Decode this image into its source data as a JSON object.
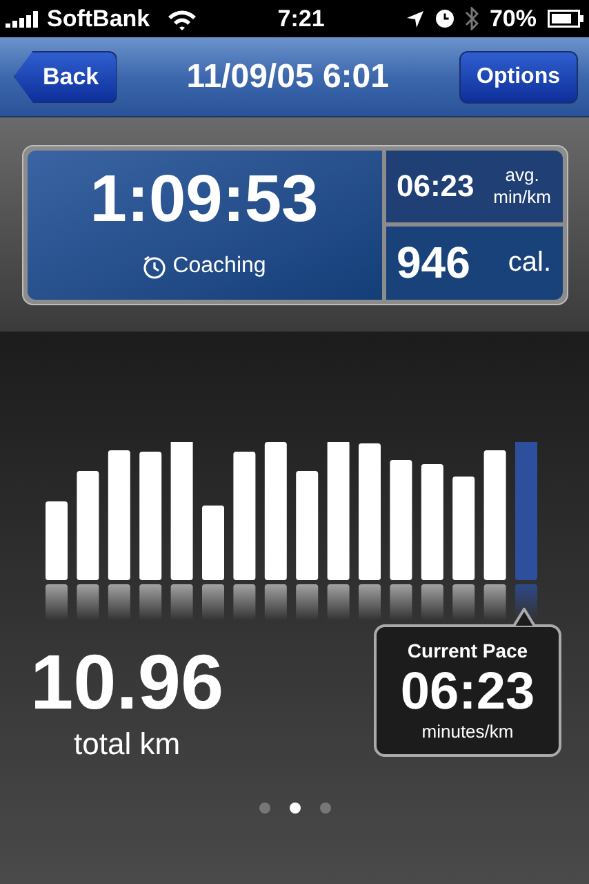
{
  "status_bar": {
    "carrier": "SoftBank",
    "time": "7:21",
    "battery": "70%"
  },
  "nav_bar": {
    "back": "Back",
    "title": "11/09/05 6:01",
    "options": "Options"
  },
  "summary": {
    "duration": "1:09:53",
    "coaching": "Coaching",
    "avg_pace": "06:23",
    "avg_unit_1": "avg.",
    "avg_unit_2": "min/km",
    "calories": "946",
    "calories_unit": "cal."
  },
  "splits": [
    {
      "selected": false
    },
    {
      "selected": false
    },
    {
      "selected": false
    },
    {
      "selected": false
    },
    {
      "selected": false
    },
    {
      "selected": false
    },
    {
      "selected": false
    },
    {
      "selected": false
    },
    {
      "selected": false
    },
    {
      "selected": false
    },
    {
      "selected": false
    },
    {
      "selected": false
    },
    {
      "selected": false
    },
    {
      "selected": false
    },
    {
      "selected": false
    },
    {
      "selected": true
    }
  ],
  "distance": {
    "value": "10.96",
    "label": "total km"
  },
  "current_pace": {
    "title": "Current Pace",
    "value": "06:23",
    "unit": "minutes/km"
  },
  "pages": [
    {
      "selected": false
    },
    {
      "selected": true
    },
    {
      "selected": false
    }
  ]
}
